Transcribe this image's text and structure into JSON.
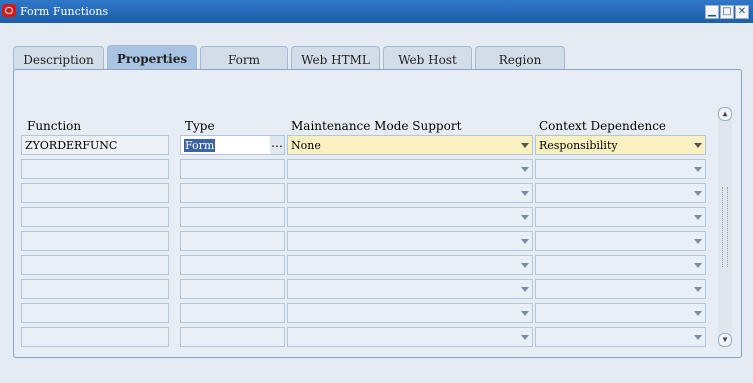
{
  "window": {
    "title": "Form Functions",
    "controls": {
      "minimize": "▁",
      "maximize": "□",
      "close": "✕"
    }
  },
  "tabs": [
    {
      "label": "Description",
      "active": false
    },
    {
      "label": "Properties",
      "active": true
    },
    {
      "label": "Form",
      "active": false
    },
    {
      "label": "Web HTML",
      "active": false
    },
    {
      "label": "Web Host",
      "active": false
    },
    {
      "label": "Region",
      "active": false
    }
  ],
  "table": {
    "headers": {
      "function": "Function",
      "type": "Type",
      "maintenance": "Maintenance Mode Support",
      "context": "Context Dependence"
    },
    "rows": [
      {
        "function": "ZYORDERFUNC",
        "type": "Form",
        "maintenance": "None",
        "context": "Responsibility"
      },
      {
        "function": "",
        "type": "",
        "maintenance": "",
        "context": ""
      },
      {
        "function": "",
        "type": "",
        "maintenance": "",
        "context": ""
      },
      {
        "function": "",
        "type": "",
        "maintenance": "",
        "context": ""
      },
      {
        "function": "",
        "type": "",
        "maintenance": "",
        "context": ""
      },
      {
        "function": "",
        "type": "",
        "maintenance": "",
        "context": ""
      },
      {
        "function": "",
        "type": "",
        "maintenance": "",
        "context": ""
      },
      {
        "function": "",
        "type": "",
        "maintenance": "",
        "context": ""
      },
      {
        "function": "",
        "type": "",
        "maintenance": "",
        "context": ""
      }
    ],
    "lov_button": "…"
  },
  "scrollbar": {
    "up": "▲",
    "down": "▼"
  },
  "colors": {
    "titlebar": "#1d5ea8",
    "required_field": "#fbf0c2",
    "active_tab": "#a9c4e2"
  }
}
